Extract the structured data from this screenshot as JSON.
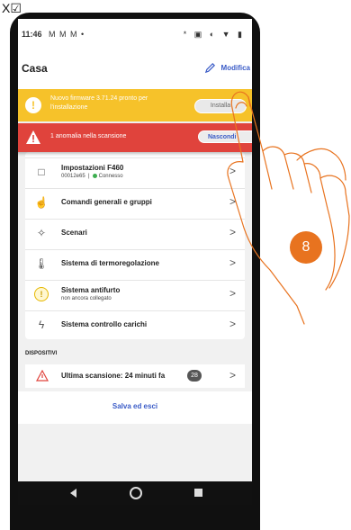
{
  "corner_mark": "X☑",
  "status_bar": {
    "time": "11:46",
    "left_icons": "M M M •",
    "right_icons": "* ▣ ◐ ▼ ▮"
  },
  "header": {
    "title": "Casa",
    "edit_label": "Modifica"
  },
  "firmware_banner": {
    "text": "Nuovo firmware 3.71.24 pronto per l'installazione",
    "button": "Installa",
    "icon": "!"
  },
  "error_banner": {
    "text": "1 anomalia nella scansione",
    "button": "Nascondi"
  },
  "card": {
    "items": [
      {
        "label": "Impostazioni F460",
        "sub_id": "00012e65",
        "sub_sep": "|",
        "sub_status": "Connesso",
        "icon": "□"
      },
      {
        "label": "Comandi generali e gruppi",
        "icon": "☝"
      },
      {
        "label": "Scenari",
        "icon": "✧"
      },
      {
        "label": "Sistema di termoregolazione",
        "icon": "🌡"
      },
      {
        "label": "Sistema antifurto",
        "sub": "non ancora collegato",
        "icon": "!"
      },
      {
        "label": "Sistema controllo carichi",
        "icon": "ϟ"
      }
    ],
    "chevron": ">"
  },
  "devices_section": {
    "title": "DISPOSITIVI",
    "row_label": "Ultima scansione: 24 minuti fa",
    "badge": "28",
    "chevron": ">"
  },
  "footer": {
    "save_label": "Salva ed esci"
  },
  "step_number": "8",
  "colors": {
    "accent": "#3a5bc7",
    "warning": "#f6c22a",
    "error": "#e0433c",
    "step": "#e8731f"
  }
}
